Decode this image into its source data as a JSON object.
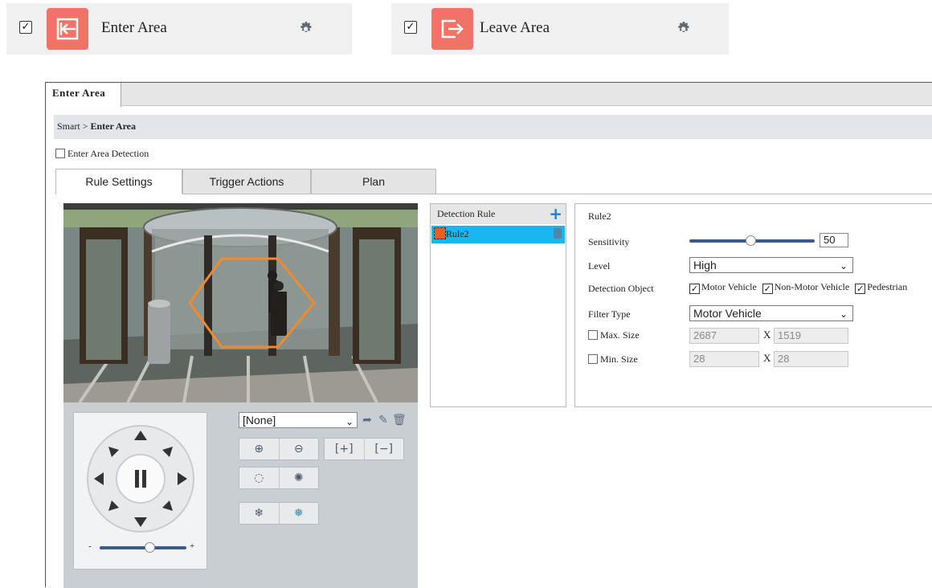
{
  "cards": [
    {
      "label": "Enter Area",
      "checked": "✓"
    },
    {
      "label": "Leave Area",
      "checked": "✓"
    }
  ],
  "panel": {
    "tab": "Enter Area",
    "breadcrumb": {
      "root": "Smart",
      "sep": ">",
      "current": "Enter Area"
    },
    "detection_checkbox_label": "Enter Area Detection",
    "subtabs": [
      "Rule Settings",
      "Trigger Actions",
      "Plan"
    ]
  },
  "ptz": {
    "preset_value": "[None]",
    "zoom_min": "-",
    "zoom_max": "+",
    "zoom_level": 0.55
  },
  "rules": {
    "header": "Detection Rule",
    "items": [
      {
        "name": "Rule2",
        "color": "#f05a24"
      }
    ]
  },
  "detail": {
    "title": "Rule2",
    "sensitivity_label": "Sensitivity",
    "sensitivity_value": "50",
    "level_label": "Level",
    "level_value": "High",
    "detection_object_label": "Detection Object",
    "objects": [
      {
        "label": "Motor Vehicle",
        "checked": "✓"
      },
      {
        "label": "Non-Motor Vehicle",
        "checked": "✓"
      },
      {
        "label": "Pedestrian",
        "checked": "✓"
      }
    ],
    "filter_type_label": "Filter Type",
    "filter_type_value": "Motor Vehicle",
    "max_size_label": "Max. Size",
    "max_w": "2687",
    "max_h": "1519",
    "min_size_label": "Min. Size",
    "min_w": "28",
    "min_h": "28",
    "x_sep": "X"
  },
  "colors": {
    "accent_tile": "#f17266",
    "selected_row": "#19b6f0",
    "add_icon": "#1b82d1",
    "rule_color": "#f05a24",
    "polygon": "#f28a2c"
  }
}
